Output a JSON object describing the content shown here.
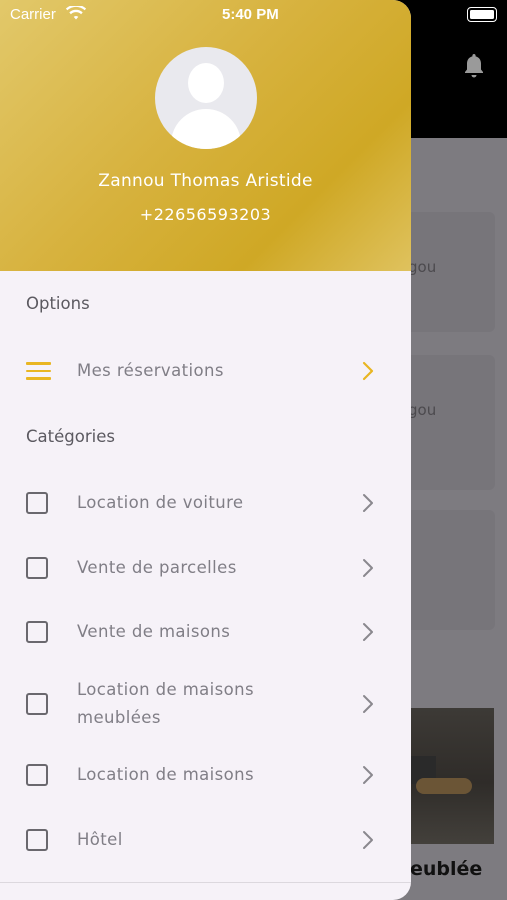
{
  "status_bar": {
    "carrier": "Carrier",
    "time": "5:40 PM"
  },
  "background": {
    "card_text_1": "gou",
    "card_text_2": "gou",
    "bottom_title": "eublée"
  },
  "profile": {
    "name": "Zannou Thomas Aristide",
    "phone": "+22656593203"
  },
  "options": {
    "title": "Options",
    "items": [
      {
        "label": "Mes réservations",
        "icon": "menu-icon"
      }
    ]
  },
  "categories": {
    "title": "Catégories",
    "items": [
      {
        "label": "Location de voiture"
      },
      {
        "label": "Vente de parcelles"
      },
      {
        "label": "Vente de maisons"
      },
      {
        "label": "Location de maisons meublées"
      },
      {
        "label": "Location de maisons"
      },
      {
        "label": "Hôtel"
      }
    ]
  },
  "colors": {
    "accent": "#E9B622",
    "header_gold": "#D7B23E",
    "drawer_bg": "#F6F2F8"
  }
}
